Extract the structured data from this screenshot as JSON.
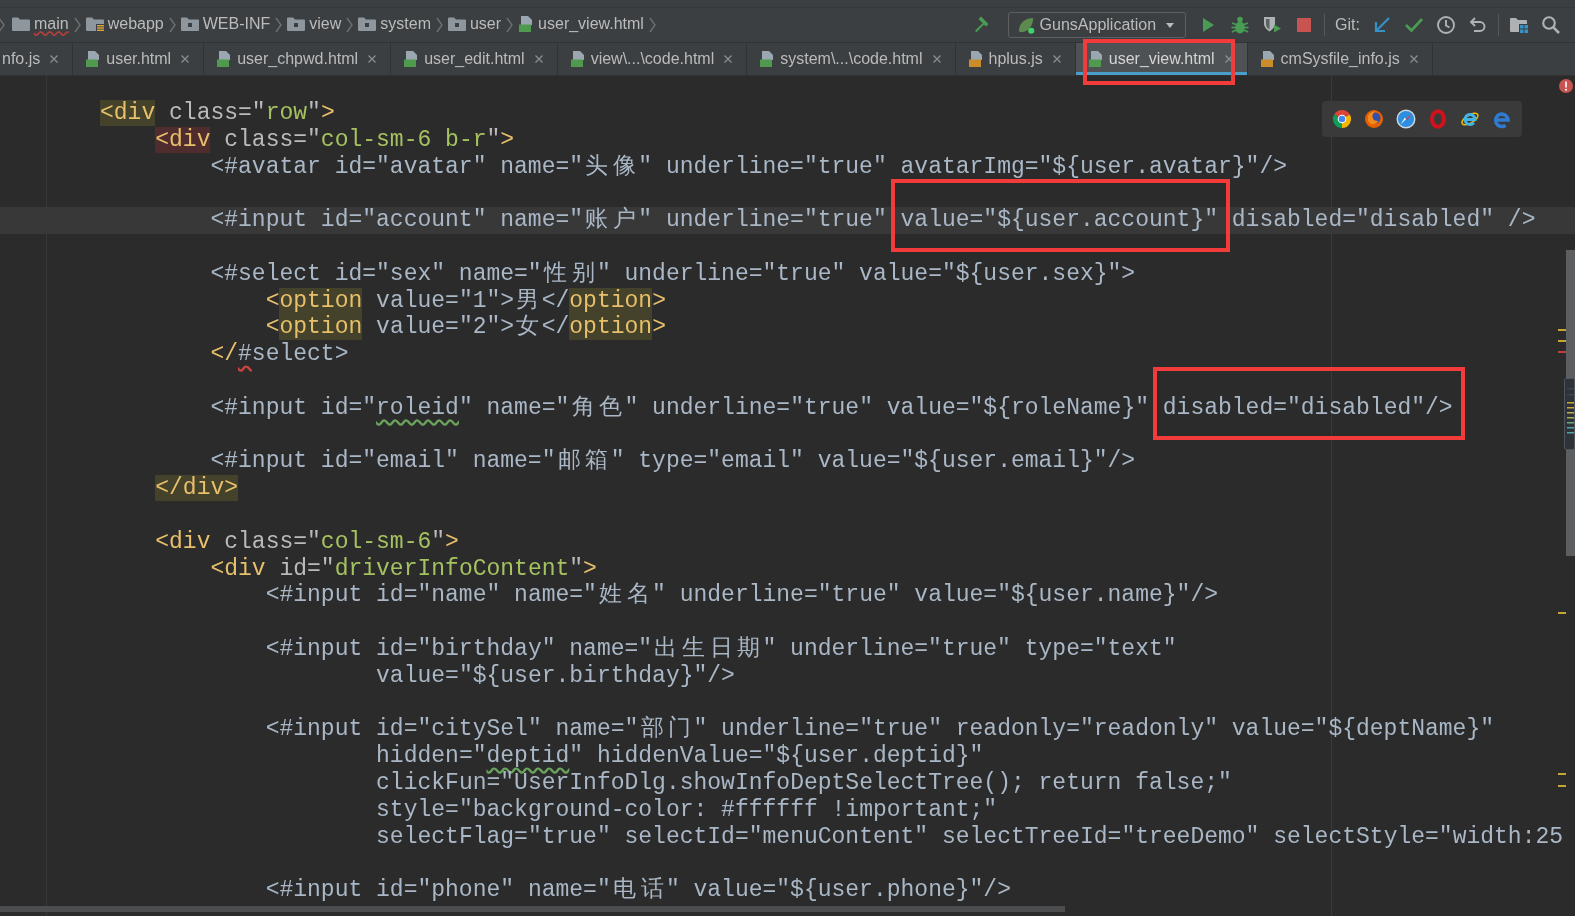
{
  "navigation_bar": {
    "breadcrumbs": [
      {
        "label": "main",
        "kind": "plain_folder",
        "spell_error": true
      },
      {
        "label": "webapp",
        "kind": "web_folder",
        "spell_error": false
      },
      {
        "label": "WEB-INF",
        "kind": "folder",
        "spell_error": false
      },
      {
        "label": "view",
        "kind": "folder",
        "spell_error": false
      },
      {
        "label": "system",
        "kind": "folder",
        "spell_error": false
      },
      {
        "label": "user",
        "kind": "folder",
        "spell_error": false
      },
      {
        "label": "user_view.html",
        "kind": "html_file",
        "spell_error": false
      }
    ]
  },
  "toolbar": {
    "run_configuration": "GunsApplication",
    "git_label": "Git:"
  },
  "tabs": [
    {
      "label": "nfo.js",
      "kind": "cut_off",
      "selected": false,
      "annotated": false
    },
    {
      "label": "user.html",
      "kind": "html_file",
      "selected": false,
      "annotated": false
    },
    {
      "label": "user_chpwd.html",
      "kind": "html_file",
      "selected": false,
      "annotated": false
    },
    {
      "label": "user_edit.html",
      "kind": "html_file",
      "selected": false,
      "annotated": false
    },
    {
      "label": "view\\...\\code.html",
      "kind": "html_file",
      "selected": false,
      "annotated": false
    },
    {
      "label": "system\\...\\code.html",
      "kind": "html_file",
      "selected": false,
      "annotated": false
    },
    {
      "label": "hplus.js",
      "kind": "js_file",
      "selected": false,
      "annotated": false
    },
    {
      "label": "user_view.html",
      "kind": "html_file",
      "selected": true,
      "annotated": true
    },
    {
      "label": "cmSysfile_info.js",
      "kind": "js_file",
      "selected": false,
      "annotated": false
    }
  ],
  "editor": {
    "lines": [
      {
        "current": false,
        "tokens": [
          {
            "kind": "tag",
            "text": "        <div",
            "match_highlight": true
          },
          {
            "kind": "attr",
            "text": " class=\""
          },
          {
            "kind": "value",
            "text": "row"
          },
          {
            "kind": "attr",
            "text": "\""
          },
          {
            "kind": "tag",
            "text": ">"
          }
        ]
      },
      {
        "current": false,
        "tokens": [
          {
            "kind": "tag",
            "text": "            <div",
            "error_highlight": true
          },
          {
            "kind": "attr",
            "text": " class=\""
          },
          {
            "kind": "value",
            "text": "col-sm-6 b-r"
          },
          {
            "kind": "attr",
            "text": "\""
          },
          {
            "kind": "tag",
            "text": ">"
          }
        ]
      },
      {
        "current": false,
        "tokens": [
          {
            "kind": "plain",
            "text": "                <#avatar id=\"avatar\" name=\"头像\" underline=\"true\" avatarImg=\"${user.avatar}\"/>"
          }
        ]
      },
      {
        "current": false
      },
      {
        "current": true,
        "tokens": [
          {
            "kind": "plain",
            "text": "                <#input id=\"account\" name=\"账户\" underline=\"true\" "
          },
          {
            "kind": "plain",
            "text": "value=\"${user.account}\"",
            "annotated": true
          },
          {
            "kind": "plain",
            "text": " disabled=\"disabled\" />"
          }
        ]
      },
      {
        "current": false
      },
      {
        "current": false,
        "tokens": [
          {
            "kind": "plain",
            "text": "                <#select id=\"sex\" name=\"性别\" underline=\"true\" value=\"${user.sex}\">"
          }
        ]
      },
      {
        "current": false,
        "tokens": [
          {
            "kind": "tag",
            "text": "                    <"
          },
          {
            "kind": "tag",
            "text": "option",
            "match_highlight": true
          },
          {
            "kind": "plain",
            "text": " value=\"1\">男</"
          },
          {
            "kind": "tag",
            "text": "option",
            "match_highlight": true
          },
          {
            "kind": "tag",
            "text": ">"
          }
        ]
      },
      {
        "current": false,
        "tokens": [
          {
            "kind": "tag",
            "text": "                    <"
          },
          {
            "kind": "tag",
            "text": "option",
            "match_highlight": true
          },
          {
            "kind": "plain",
            "text": " value=\"2\">女</"
          },
          {
            "kind": "tag",
            "text": "option",
            "match_highlight": true
          },
          {
            "kind": "tag",
            "text": ">"
          }
        ]
      },
      {
        "current": false,
        "tokens": [
          {
            "kind": "tag",
            "text": "                </"
          },
          {
            "kind": "plain",
            "text": "#",
            "error_underline": true
          },
          {
            "kind": "plain",
            "text": "select>"
          }
        ]
      },
      {
        "current": false
      },
      {
        "current": false,
        "tokens": [
          {
            "kind": "plain",
            "text": "                <#input id=\""
          },
          {
            "kind": "plain",
            "text": "roleid",
            "typo_underline": true
          },
          {
            "kind": "plain",
            "text": "\" name=\"角色\" underline=\"true\" value=\"${roleName}\" "
          },
          {
            "kind": "plain",
            "text": "disabled=\"disabled\"/>",
            "annotated": true
          }
        ]
      },
      {
        "current": false
      },
      {
        "current": false,
        "tokens": [
          {
            "kind": "plain",
            "text": "                <#input id=\"email\" name=\"邮箱\" type=\"email\" value=\"${user.email}\"/>"
          }
        ]
      },
      {
        "current": false,
        "tokens": [
          {
            "kind": "tag",
            "text": "            </div>",
            "match_highlight": true
          }
        ]
      },
      {
        "current": false
      },
      {
        "current": false,
        "tokens": [
          {
            "kind": "tag",
            "text": "            <div"
          },
          {
            "kind": "attr",
            "text": " class=\""
          },
          {
            "kind": "value",
            "text": "col-sm-6"
          },
          {
            "kind": "attr",
            "text": "\""
          },
          {
            "kind": "tag",
            "text": ">"
          }
        ]
      },
      {
        "current": false,
        "tokens": [
          {
            "kind": "tag",
            "text": "                <div"
          },
          {
            "kind": "attr",
            "text": " id=\""
          },
          {
            "kind": "value",
            "text": "driverInfoContent"
          },
          {
            "kind": "attr",
            "text": "\""
          },
          {
            "kind": "tag",
            "text": ">"
          }
        ]
      },
      {
        "current": false,
        "tokens": [
          {
            "kind": "plain",
            "text": "                    <#input id=\"name\" name=\"姓名\" underline=\"true\" value=\"${user.name}\"/>"
          }
        ]
      },
      {
        "current": false
      },
      {
        "current": false,
        "tokens": [
          {
            "kind": "plain",
            "text": "                    <#input id=\"birthday\" name=\"出生日期\" underline=\"true\" type=\"text\""
          }
        ]
      },
      {
        "current": false,
        "tokens": [
          {
            "kind": "plain",
            "text": "                            value=\"${user.birthday}\"/>"
          }
        ]
      },
      {
        "current": false
      },
      {
        "current": false,
        "tokens": [
          {
            "kind": "plain",
            "text": "                    <#input id=\"citySel\" name=\"部门\" underline=\"true\" readonly=\"readonly\" value=\"${deptName}\""
          }
        ]
      },
      {
        "current": false,
        "tokens": [
          {
            "kind": "plain",
            "text": "                            hidden=\""
          },
          {
            "kind": "plain",
            "text": "deptid",
            "typo_underline": true
          },
          {
            "kind": "plain",
            "text": "\" hiddenValue=\"${user.deptid}\""
          }
        ]
      },
      {
        "current": false,
        "tokens": [
          {
            "kind": "plain",
            "text": "                            clickFun=\"UserInfoDlg.showInfoDeptSelectTree(); return false;\""
          }
        ]
      },
      {
        "current": false,
        "tokens": [
          {
            "kind": "plain",
            "text": "                            style=\"background-color: #ffffff !important;\""
          }
        ]
      },
      {
        "current": false,
        "tokens": [
          {
            "kind": "plain",
            "text": "                            selectFlag=\"true\" selectId=\"menuContent\" selectTreeId=\"treeDemo\" selectStyle=\"width:25"
          }
        ]
      },
      {
        "current": false
      },
      {
        "current": false,
        "tokens": [
          {
            "kind": "plain",
            "text": "                    <#input id=\"phone\" name=\"电话\" value=\"${user.phone}\"/>"
          }
        ]
      }
    ]
  }
}
